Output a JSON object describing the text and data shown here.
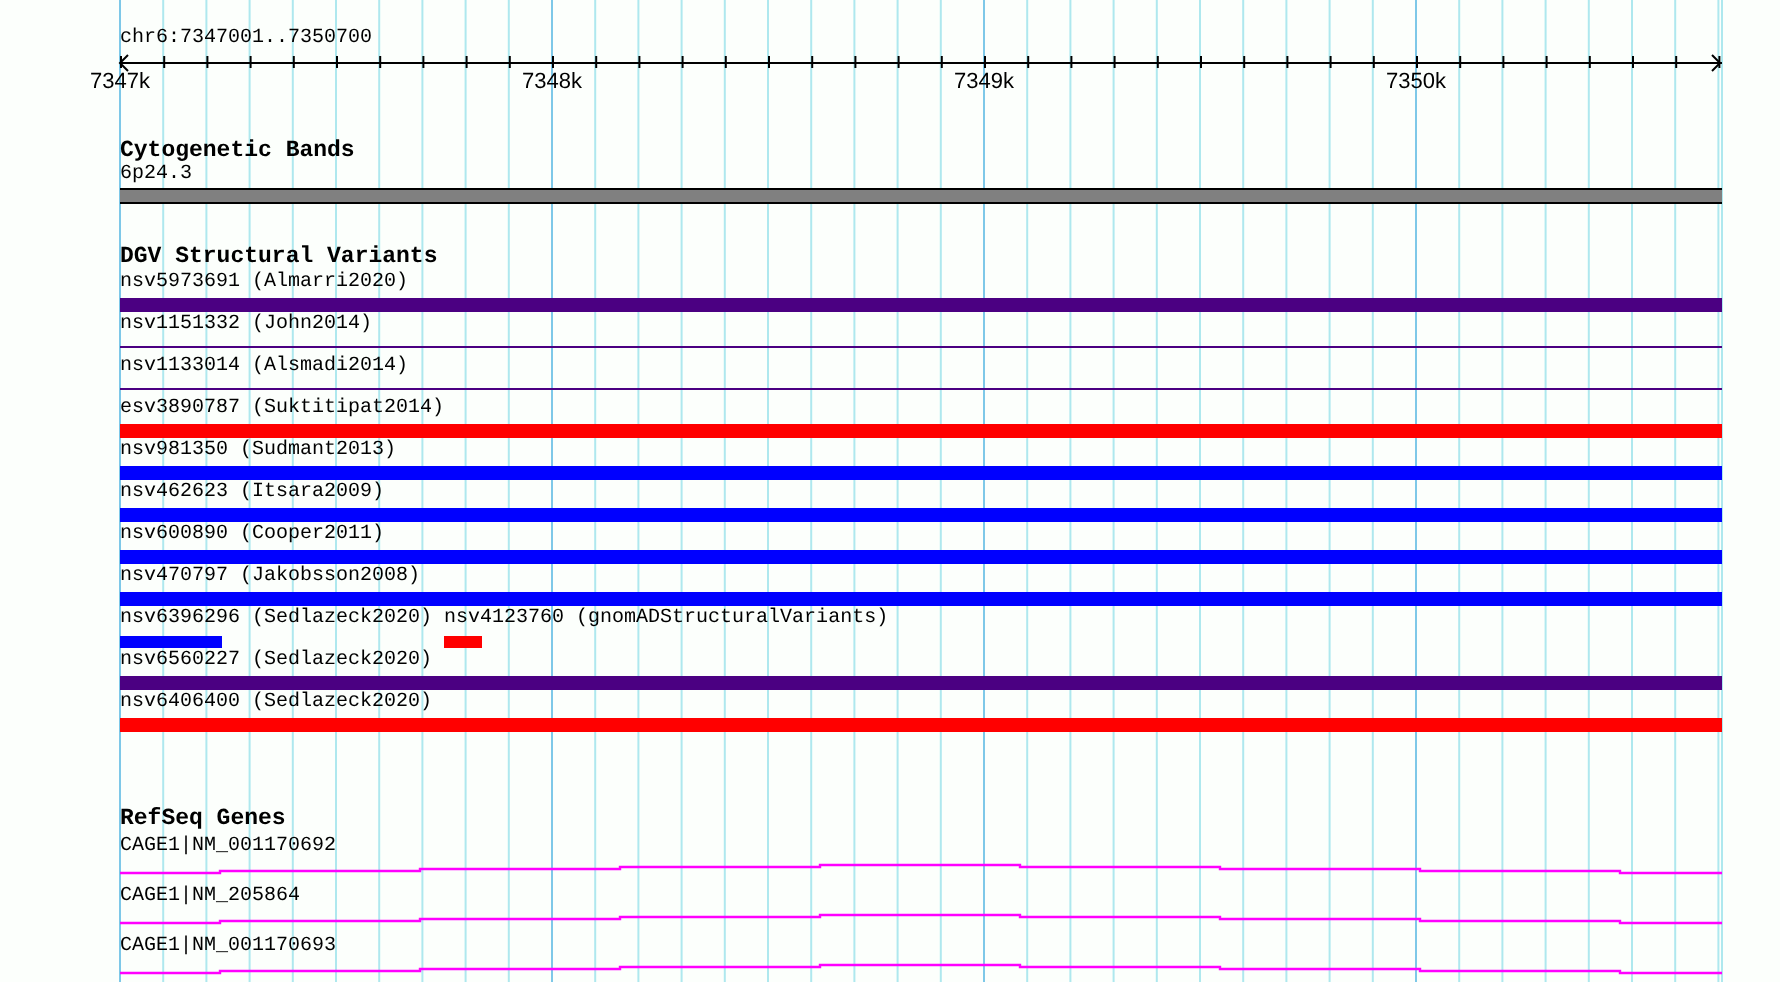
{
  "ruler": {
    "location": "chr6:7347001..7350700",
    "ticks": [
      "7347k",
      "7348k",
      "7349k",
      "7350k"
    ]
  },
  "tracks": [
    {
      "kind": "bands",
      "title": "Cytogenetic Bands",
      "features": [
        {
          "label": "6p24.3",
          "color": "#808080"
        }
      ]
    },
    {
      "kind": "variants",
      "title": "DGV Structural Variants",
      "rows": [
        [
          {
            "label": "nsv5973691 (Almarri2020)",
            "color": "#4b0082",
            "kind": "thick"
          }
        ],
        [
          {
            "label": "nsv1151332 (John2014)",
            "color": "#4b0082",
            "kind": "thin"
          }
        ],
        [
          {
            "label": "nsv1133014 (Alsmadi2014)",
            "color": "#4b0082",
            "kind": "thin"
          }
        ],
        [
          {
            "label": "esv3890787 (Suktitipat2014)",
            "color": "#ff0000",
            "kind": "thick"
          }
        ],
        [
          {
            "label": "nsv981350 (Sudmant2013)",
            "color": "#0000ff",
            "kind": "thick"
          }
        ],
        [
          {
            "label": "nsv462623 (Itsara2009)",
            "color": "#0000ff",
            "kind": "thick"
          }
        ],
        [
          {
            "label": "nsv600890 (Cooper2011)",
            "color": "#0000ff",
            "kind": "thick"
          }
        ],
        [
          {
            "label": "nsv470797 (Jakobsson2008)",
            "color": "#0000ff",
            "kind": "thick"
          }
        ],
        [
          {
            "label": "nsv6396296 (Sedlazeck2020)",
            "color": "#0000ff",
            "kind": "short"
          },
          {
            "label": "nsv4123760 (gnomADStructuralVariants)",
            "color": "#ff0000",
            "kind": "tiny"
          }
        ],
        [
          {
            "label": "nsv6560227 (Sedlazeck2020)",
            "color": "#4b0082",
            "kind": "thick"
          }
        ],
        [
          {
            "label": "nsv6406400 (Sedlazeck2020)",
            "color": "#ff0000",
            "kind": "thick"
          }
        ]
      ]
    },
    {
      "kind": "genes",
      "title": "RefSeq Genes",
      "features": [
        {
          "label": "CAGE1|NM_001170692"
        },
        {
          "label": "CAGE1|NM_205864"
        },
        {
          "label": "CAGE1|NM_001170693"
        }
      ]
    }
  ]
}
